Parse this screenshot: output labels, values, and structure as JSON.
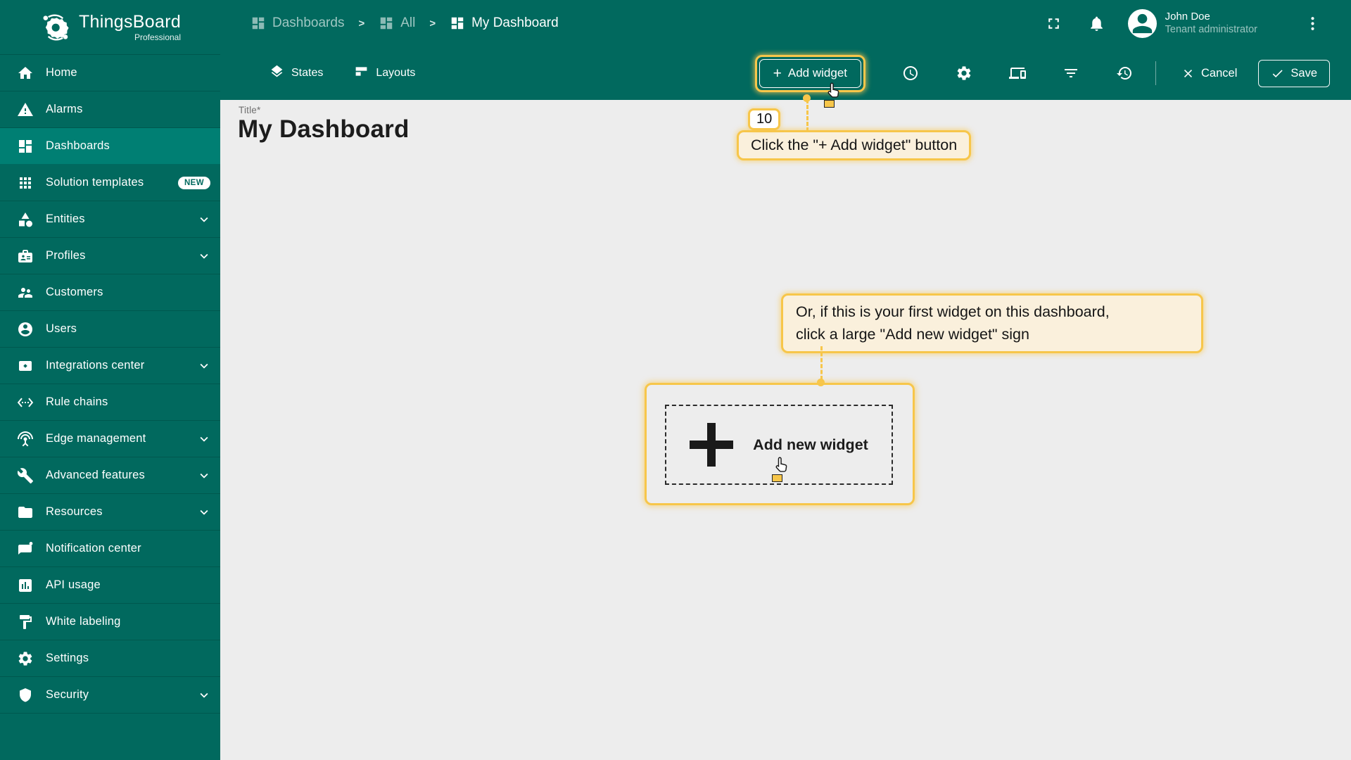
{
  "app": {
    "brand": "ThingsBoard",
    "brand_sub": "Professional"
  },
  "colors": {
    "teal": "#01695e",
    "teal_selected": "#007f73",
    "highlight": "#f7c64a",
    "tooltip_bg": "#faf0dc",
    "content_bg": "#ededed"
  },
  "sidebar": {
    "items": [
      {
        "label": "Home",
        "icon": "home"
      },
      {
        "label": "Alarms",
        "icon": "warning"
      },
      {
        "label": "Dashboards",
        "icon": "dashboard",
        "selected": true
      },
      {
        "label": "Solution templates",
        "icon": "apps",
        "badge": "NEW"
      },
      {
        "label": "Entities",
        "icon": "category",
        "expandable": true
      },
      {
        "label": "Profiles",
        "icon": "badge",
        "expandable": true
      },
      {
        "label": "Customers",
        "icon": "people"
      },
      {
        "label": "Users",
        "icon": "account"
      },
      {
        "label": "Integrations center",
        "icon": "integration",
        "expandable": true
      },
      {
        "label": "Rule chains",
        "icon": "code-brackets"
      },
      {
        "label": "Edge management",
        "icon": "antenna",
        "expandable": true
      },
      {
        "label": "Advanced features",
        "icon": "tools",
        "expandable": true
      },
      {
        "label": "Resources",
        "icon": "folder",
        "expandable": true
      },
      {
        "label": "Notification center",
        "icon": "message-dot"
      },
      {
        "label": "API usage",
        "icon": "bar-chart"
      },
      {
        "label": "White labeling",
        "icon": "paint"
      },
      {
        "label": "Settings",
        "icon": "gear"
      },
      {
        "label": "Security",
        "icon": "shield",
        "expandable": true
      }
    ]
  },
  "breadcrumb": {
    "separator": ">",
    "items": [
      {
        "label": "Dashboards",
        "icon": "dashboard",
        "active": false
      },
      {
        "label": "All",
        "icon": "dashboard",
        "active": false
      },
      {
        "label": "My Dashboard",
        "icon": "dashboard",
        "active": true
      }
    ]
  },
  "header": {
    "user": {
      "name": "John Doe",
      "role": "Tenant administrator"
    }
  },
  "toolbar": {
    "states_label": "States",
    "layouts_label": "Layouts",
    "add_widget_plus": "+",
    "add_widget_label": "Add widget",
    "cancel_label": "Cancel",
    "save_label": "Save",
    "icon_buttons": [
      {
        "name": "timewindow",
        "icon": "clock"
      },
      {
        "name": "dashboard-settings",
        "icon": "gear"
      },
      {
        "name": "manage-layouts",
        "icon": "devices"
      },
      {
        "name": "entity-filter",
        "icon": "filter"
      },
      {
        "name": "version-history",
        "icon": "history"
      }
    ]
  },
  "content": {
    "title_label": "Title*",
    "title_value": "My Dashboard"
  },
  "tutorial": {
    "step_number": "10",
    "step1_text": "Click the \"+ Add widget\" button",
    "step2_line1": "Or, if this is your first widget on this dashboard,",
    "step2_line2": "click a large \"Add new widget\" sign",
    "add_new_widget_label": "Add new widget"
  }
}
